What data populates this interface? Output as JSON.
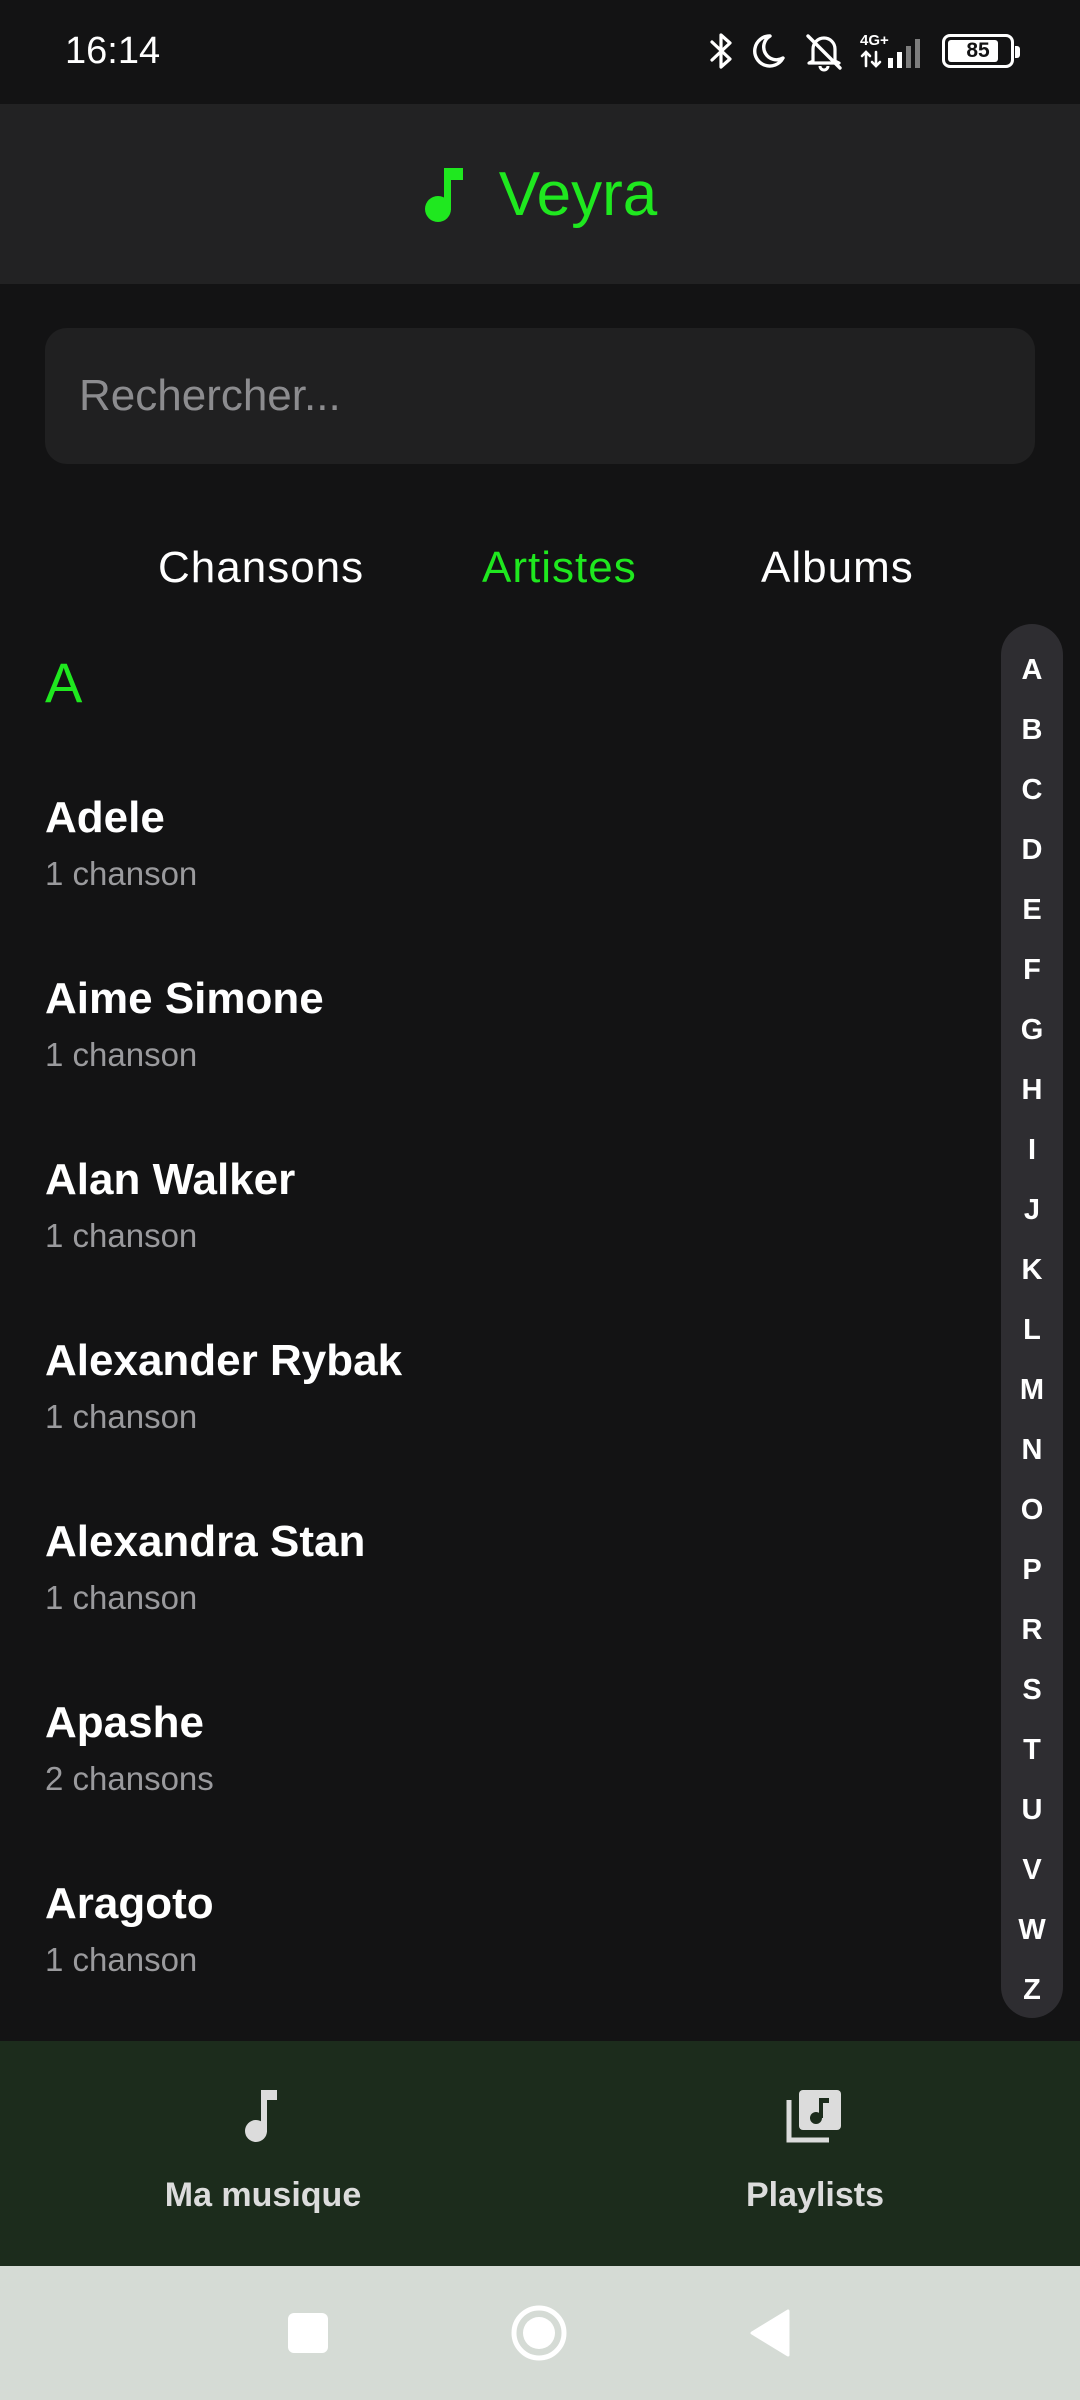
{
  "status_bar": {
    "time": "16:14",
    "network_label": "4G+",
    "battery": "85",
    "battery_level": 0.85
  },
  "header": {
    "title": "Veyra",
    "icon": "music-note-icon",
    "accent_color": "#1fe81f"
  },
  "search": {
    "placeholder": "Rechercher...",
    "value": ""
  },
  "tabs": [
    {
      "label": "Chansons",
      "active": false
    },
    {
      "label": "Artistes",
      "active": true
    },
    {
      "label": "Albums",
      "active": false
    }
  ],
  "section": {
    "letter": "A"
  },
  "artists": [
    {
      "name": "Adele",
      "count": "1 chanson"
    },
    {
      "name": "Aime Simone",
      "count": "1 chanson"
    },
    {
      "name": "Alan Walker",
      "count": "1 chanson"
    },
    {
      "name": "Alexander Rybak",
      "count": "1 chanson"
    },
    {
      "name": "Alexandra Stan",
      "count": "1 chanson"
    },
    {
      "name": "Apashe",
      "count": "2 chansons"
    },
    {
      "name": "Aragoto",
      "count": "1 chanson"
    }
  ],
  "alphabet": [
    "A",
    "B",
    "C",
    "D",
    "E",
    "F",
    "G",
    "H",
    "I",
    "J",
    "K",
    "L",
    "M",
    "N",
    "O",
    "P",
    "R",
    "S",
    "T",
    "U",
    "V",
    "W",
    "Z"
  ],
  "bottom_nav": [
    {
      "label": "Ma musique",
      "icon": "music-note-icon"
    },
    {
      "label": "Playlists",
      "icon": "library-music-icon"
    }
  ]
}
